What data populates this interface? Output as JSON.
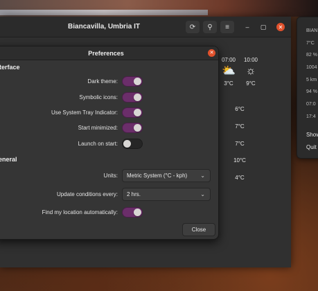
{
  "window": {
    "title": "Biancavilla, Umbria IT",
    "refresh_icon": "refresh-icon",
    "location_icon": "location-pin-icon",
    "menu_icon": "hamburger-menu-icon"
  },
  "hourly": [
    {
      "time": "07:00",
      "temp": "3°C",
      "icon": "partly-cloudy-icon"
    },
    {
      "time": "10:00",
      "temp": "9°C",
      "icon": "sunny-icon"
    }
  ],
  "daily_temps": [
    "6°C",
    "7°C",
    "7°C",
    "10°C",
    "4°C"
  ],
  "side_menu": {
    "items": [
      "BIAN",
      "7°C",
      "82 %",
      "1004",
      "5 km",
      "94 %",
      "07:0",
      "17:4"
    ],
    "actions": [
      "Show",
      "Quit"
    ]
  },
  "preferences": {
    "title": "Preferences",
    "interface_section": "Interface",
    "general_section": "General",
    "dark_theme_label": "Dark theme:",
    "dark_theme_on": true,
    "symbolic_icons_label": "Symbolic icons:",
    "symbolic_icons_on": true,
    "tray_label": "Use System Tray Indicator:",
    "tray_on": true,
    "start_min_label": "Start minimized:",
    "start_min_on": true,
    "launch_label": "Launch on start:",
    "launch_on": false,
    "units_label": "Units:",
    "units_value": "Metric System  (°C - kph)",
    "update_label": "Update conditions every:",
    "update_value": "2 hrs.",
    "find_loc_label": "Find my location automatically:",
    "find_loc_on": true,
    "close_label": "Close"
  },
  "colors": {
    "accent": "#6b2e6a",
    "close": "#e0512c"
  }
}
